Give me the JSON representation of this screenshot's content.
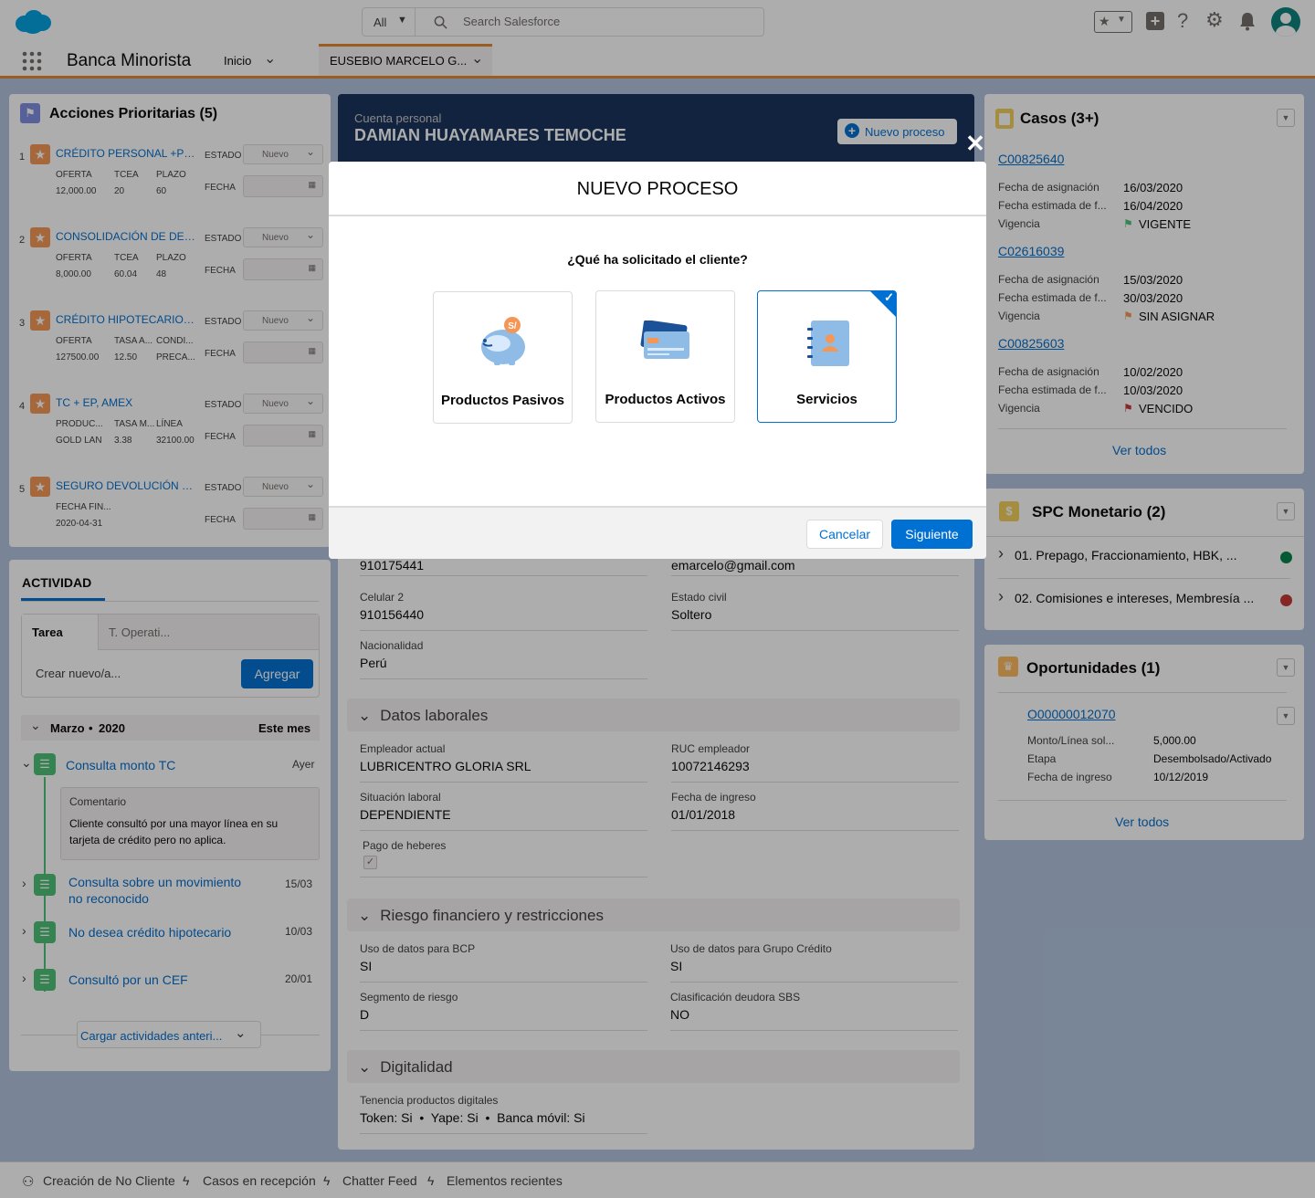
{
  "header": {
    "search_scope": "All",
    "search_placeholder": "Search Salesforce"
  },
  "nav": {
    "app_name": "Banca Minorista",
    "tab_home": "Inicio",
    "tab_record": "EUSEBIO MARCELO G..."
  },
  "priority_actions": {
    "title": "Acciones Prioritarias (5)",
    "estado_label": "ESTADO",
    "fecha_label": "FECHA",
    "items": [
      {
        "num": "1",
        "title": "CRÉDITO PERSONAL +PDH",
        "estado": "Nuevo",
        "c1_label": "OFERTA",
        "c1_val": "12,000.00",
        "c2_label": "TCEA",
        "c2_val": "20",
        "c3_label": "PLAZO",
        "c3_val": "60"
      },
      {
        "num": "2",
        "title": "CONSOLIDACIÓN DE DEUD...",
        "estado": "Nuevo",
        "c1_label": "OFERTA",
        "c1_val": "8,000.00",
        "c2_label": "TCEA",
        "c2_val": "60.04",
        "c3_label": "PLAZO",
        "c3_val": "48"
      },
      {
        "num": "3",
        "title": "CRÉDITO HIPOTECARIO, VE...",
        "estado": "Nuevo",
        "c1_label": "OFERTA",
        "c1_val": "127500.00",
        "c2_label": "TASA A...",
        "c2_val": "12.50",
        "c3_label": "CONDI...",
        "c3_val": "PRECA..."
      },
      {
        "num": "4",
        "title": "TC + EP, AMEX",
        "estado": "Nuevo",
        "c1_label": "PRODUC...",
        "c1_val": "GOLD LAN",
        "c2_label": "TASA M...",
        "c2_val": "3.38",
        "c3_label": "LÍNEA",
        "c3_val": "32100.00"
      },
      {
        "num": "5",
        "title": "SEGURO DEVOLUCIÓN PLUS",
        "estado": "Nuevo",
        "c1_label": "FECHA FIN...",
        "c1_val": "2020-04-31",
        "c2_label": "",
        "c2_val": "",
        "c3_label": "",
        "c3_val": ""
      }
    ]
  },
  "activity": {
    "tab": "ACTIVIDAD",
    "subtab_task": "Tarea",
    "subtab_other": "T. Operati...",
    "new_placeholder": "Crear nuevo/a...",
    "add_button": "Agregar",
    "month": "Marzo",
    "year": "2020",
    "this_month": "Este mes",
    "items": [
      {
        "title": "Consulta monto TC",
        "date": "Ayer",
        "comment_label": "Comentario",
        "comment": "Cliente consultó por una mayor línea en su tarjeta de crédito pero no aplica."
      },
      {
        "title": "Consulta sobre un movimiento no reconocido",
        "date": "15/03"
      },
      {
        "title": "No desea crédito hipotecario",
        "date": "10/03"
      },
      {
        "title": "Consultó por un CEF",
        "date": "20/01"
      }
    ],
    "load_more": "Cargar actividades anteri..."
  },
  "account": {
    "type": "Cuenta personal",
    "name": "DAMIAN HUAYAMARES TEMOCHE",
    "new_process_button": "Nuevo proceso"
  },
  "details": {
    "phone_val": "910175441",
    "email_val": "emarcelo@gmail.com",
    "cel2_label": "Celular 2",
    "cel2_val": "910156440",
    "civil_label": "Estado civil",
    "civil_val": "Soltero",
    "nat_label": "Nacionalidad",
    "nat_val": "Perú",
    "sec_laborales": "Datos laborales",
    "emp_label": "Empleador actual",
    "emp_val": "LUBRICENTRO GLORIA SRL",
    "ruc_label": "RUC empleador",
    "ruc_val": "10072146293",
    "sit_label": "Situación laboral",
    "sit_val": "DEPENDIENTE",
    "ing_label": "Fecha de ingreso",
    "ing_val": "01/01/2018",
    "hab_label": "Pago de heberes",
    "sec_riesgo": "Riesgo financiero y restricciones",
    "bcp_label": "Uso de datos para BCP",
    "bcp_val": "SI",
    "grupo_label": "Uso de datos para Grupo Crédito",
    "grupo_val": "SI",
    "seg_label": "Segmento de riesgo",
    "seg_val": "D",
    "sbs_label": "Clasificación deudora SBS",
    "sbs_val": "NO",
    "sec_digital": "Digitalidad",
    "dig_label": "Tenencia productos digitales",
    "dig_val": "Token: Si  •  Yape: Si  •  Banca móvil: Si"
  },
  "cases": {
    "title": "Casos (3+)",
    "items": [
      {
        "id": "C00825640",
        "l1": "Fecha de asignación",
        "v1": "16/03/2020",
        "l2": "Fecha estimada de f...",
        "v2": "16/04/2020",
        "l3": "Vigencia",
        "v3": "VIGENTE",
        "flag": "#4bc076"
      },
      {
        "id": "C02616039",
        "l1": "Fecha de asignación",
        "v1": "15/03/2020",
        "l2": "Fecha estimada de f...",
        "v2": "30/03/2020",
        "l3": "Vigencia",
        "v3": "SIN ASIGNAR",
        "flag": "#f49756"
      },
      {
        "id": "C00825603",
        "l1": "Fecha de asignación",
        "v1": "10/02/2020",
        "l2": "Fecha estimada de f...",
        "v2": "10/03/2020",
        "l3": "Vigencia",
        "v3": "VENCIDO",
        "flag": "#c23934"
      }
    ],
    "view_all": "Ver todos"
  },
  "spc": {
    "title": "SPC Monetario (2)",
    "items": [
      {
        "label": "01. Prepago, Fraccionamiento, HBK, ...",
        "status": "#04844b"
      },
      {
        "label": "02. Comisiones e intereses, Membresía ...",
        "status": "#c23934"
      }
    ]
  },
  "opps": {
    "title": "Oportunidades (1)",
    "id": "O00000012070",
    "l1": "Monto/Línea sol...",
    "v1": "5,000.00",
    "l2": "Etapa",
    "v2": "Desembolsado/Activado",
    "l3": "Fecha de ingreso",
    "v3": "10/12/2019",
    "view_all": "Ver todos"
  },
  "modal": {
    "title": "NUEVO PROCESO",
    "question": "¿Qué ha solicitado el cliente?",
    "options": [
      "Productos Pasivos",
      "Productos Activos",
      "Servicios"
    ],
    "badge": "S/",
    "cancel": "Cancelar",
    "next": "Siguiente"
  },
  "utility": {
    "items": [
      "Creación de No Cliente",
      "Casos en recepción",
      "Chatter Feed",
      "Elementos recientes"
    ]
  },
  "colors": {
    "brand": "#0070d2",
    "header_dark": "#16325c",
    "accent_orange": "#e0882f"
  }
}
